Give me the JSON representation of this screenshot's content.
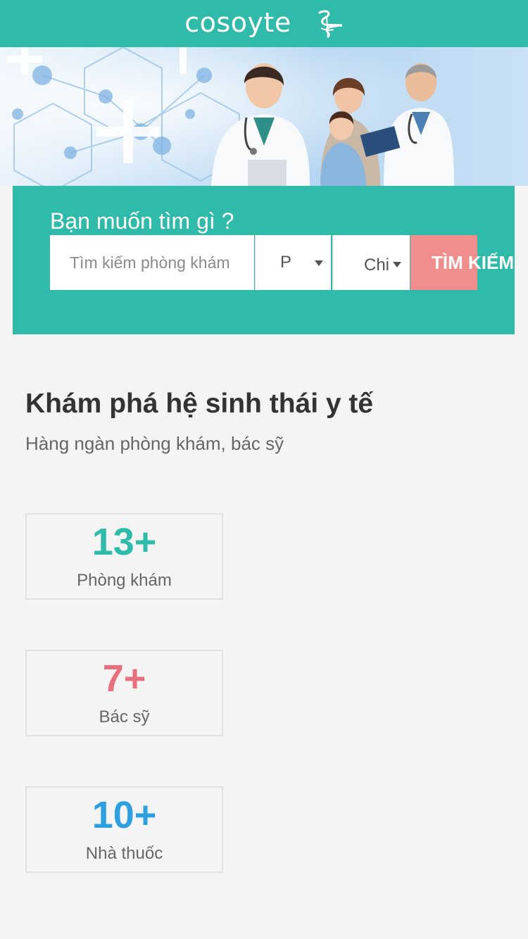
{
  "header": {
    "logo_text": "cosoyte",
    "logo_icon": "caduceus-icon",
    "background": "#2fbaa9"
  },
  "banner": {
    "image": "doctors-with-family-banner"
  },
  "search": {
    "title": "Bạn muốn tìm gì ?",
    "input_placeholder": "Tìm kiếm phòng khám",
    "select_1_value": "P",
    "select_2_value": "Chi",
    "button_label": "TÌM KIẾM",
    "button_color": "#f08d8d"
  },
  "explore": {
    "title": "Khám phá hệ sinh thái y tế",
    "subtitle": "Hàng ngàn phòng khám, bác sỹ",
    "stats": [
      {
        "value": "13+",
        "label": "Phòng khám",
        "color": "#2fbaa9"
      },
      {
        "value": "7+",
        "label": "Bác sỹ",
        "color": "#e8707c"
      },
      {
        "value": "10+",
        "label": "Nhà thuốc",
        "color": "#2e9fe0"
      }
    ]
  }
}
